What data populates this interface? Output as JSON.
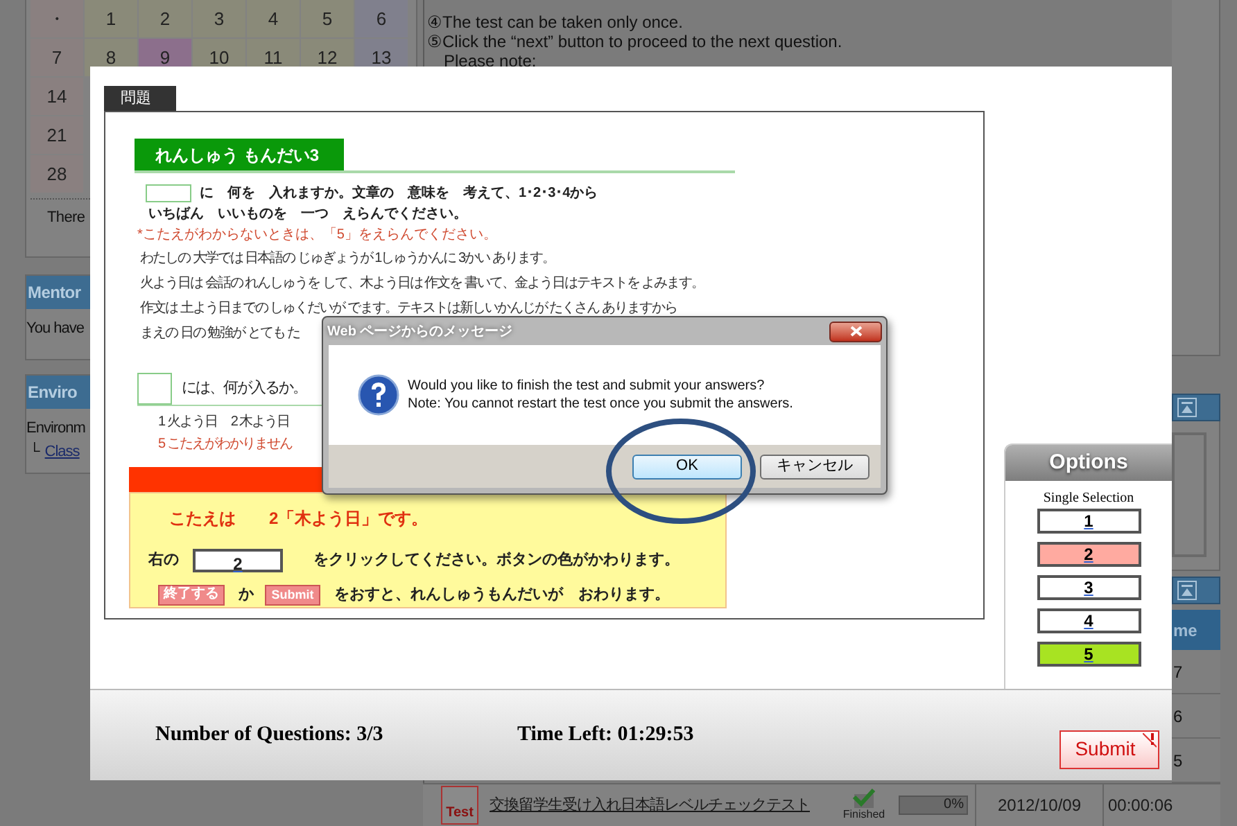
{
  "background_page": {
    "calendar": {
      "weeks": [
        {
          "days": [
            {
              "label": "・",
              "selected": false
            },
            {
              "label": "1",
              "selected": false
            },
            {
              "label": "2",
              "selected": false
            },
            {
              "label": "3",
              "selected": false
            },
            {
              "label": "4",
              "selected": false
            },
            {
              "label": "5",
              "selected": false
            },
            {
              "label": "6",
              "selected": false
            }
          ]
        },
        {
          "days": [
            {
              "label": "7",
              "selected": false
            },
            {
              "label": "8",
              "selected": false
            },
            {
              "label": "9",
              "selected": true
            },
            {
              "label": "10",
              "selected": false
            },
            {
              "label": "11",
              "selected": false
            },
            {
              "label": "12",
              "selected": false
            },
            {
              "label": "13",
              "selected": false
            }
          ]
        },
        {
          "days": [
            {
              "label": "14",
              "selected": false
            }
          ]
        },
        {
          "days": [
            {
              "label": "21",
              "selected": false
            }
          ]
        },
        {
          "days": [
            {
              "label": "28",
              "selected": false
            }
          ]
        }
      ],
      "note": "There"
    },
    "mentor_panel": {
      "title": "Mentor",
      "text": "You have"
    },
    "environment_panel": {
      "title": "Enviro",
      "text": "Environm",
      "link_prefix": "└",
      "link": "Class"
    },
    "instructions": [
      {
        "kind": "item",
        "text": "④The test can be taken only once."
      },
      {
        "kind": "item",
        "text": "⑤Click the “next” button to proceed to the next question."
      },
      {
        "kind": "heading",
        "text": "Please note:"
      }
    ],
    "time_column": {
      "header": "me",
      "cells": [
        "7",
        "6",
        "5"
      ]
    },
    "test_row": {
      "icon_label": "Test",
      "title": "交換留学生受け入れ日本語レベルチェックテスト",
      "status": "Finished",
      "progress": {
        "level": 0,
        "reading": "0%"
      },
      "date": "2012/10/09",
      "time": "00:00:06"
    }
  },
  "modal": {
    "tab": "問題",
    "question": {
      "heading": "れんしゅう もんだい3",
      "instruction_1": "に　何を　入れますか。文章の　意味を　考えて、1･2･3･4から",
      "instruction_2": "いちばん　いいものを　一つ　えらんでください。",
      "note": "*こたえがわからないときは、「5」をえらんでください。",
      "passage": [
        "わたしの 大学では 日本語の じゅぎょうが 1しゅうかんに 3かい あります。",
        "火よう日は 会話の れんしゅうを して、木よう日は 作文を 書いて、金よう日はテキストを よみます。",
        "作文は 土よう日までの しゅくだいが でます。テキストは新しいかんじが たくさん ありますから",
        "まえの 日の 勉強が とても た"
      ],
      "prompt": "には、何が入るか。",
      "choices": [
        "1 火よう日",
        "2 木よう日"
      ],
      "choice_5": "5 こたえがわかりません"
    },
    "answer_panel": {
      "answer": "こたえは　　2「木よう日」です。",
      "line_1_before": "右の",
      "line_1_button": "2",
      "line_1_after": "をクリックしてください。ボタンの色がかわります。",
      "finish_button": "終了する",
      "or": "か",
      "submit_button": "Submit",
      "line_2_after": "をおすと、れんしゅうもんだいが　おわります。"
    },
    "options_panel": {
      "title": "Options",
      "mode": "Single Selection",
      "options": [
        {
          "label": "1"
        },
        {
          "label": "2",
          "color": "#ffaaa0"
        },
        {
          "label": "3"
        },
        {
          "label": "4"
        },
        {
          "label": "5",
          "color": "#a8e322"
        }
      ]
    },
    "footer": {
      "questions": "Number of Questions: 3/3",
      "time_left": "Time Left: 01:29:53",
      "submit": "Submit"
    }
  },
  "dialog": {
    "title": "Web ページからのメッセージ",
    "message": [
      "Would you like to finish the test and submit your answers?",
      "Note: You cannot restart the test once you submit the answers."
    ],
    "buttons": [
      {
        "label": "OK",
        "default": true
      },
      {
        "label": "キャンセル",
        "default": false
      }
    ]
  }
}
